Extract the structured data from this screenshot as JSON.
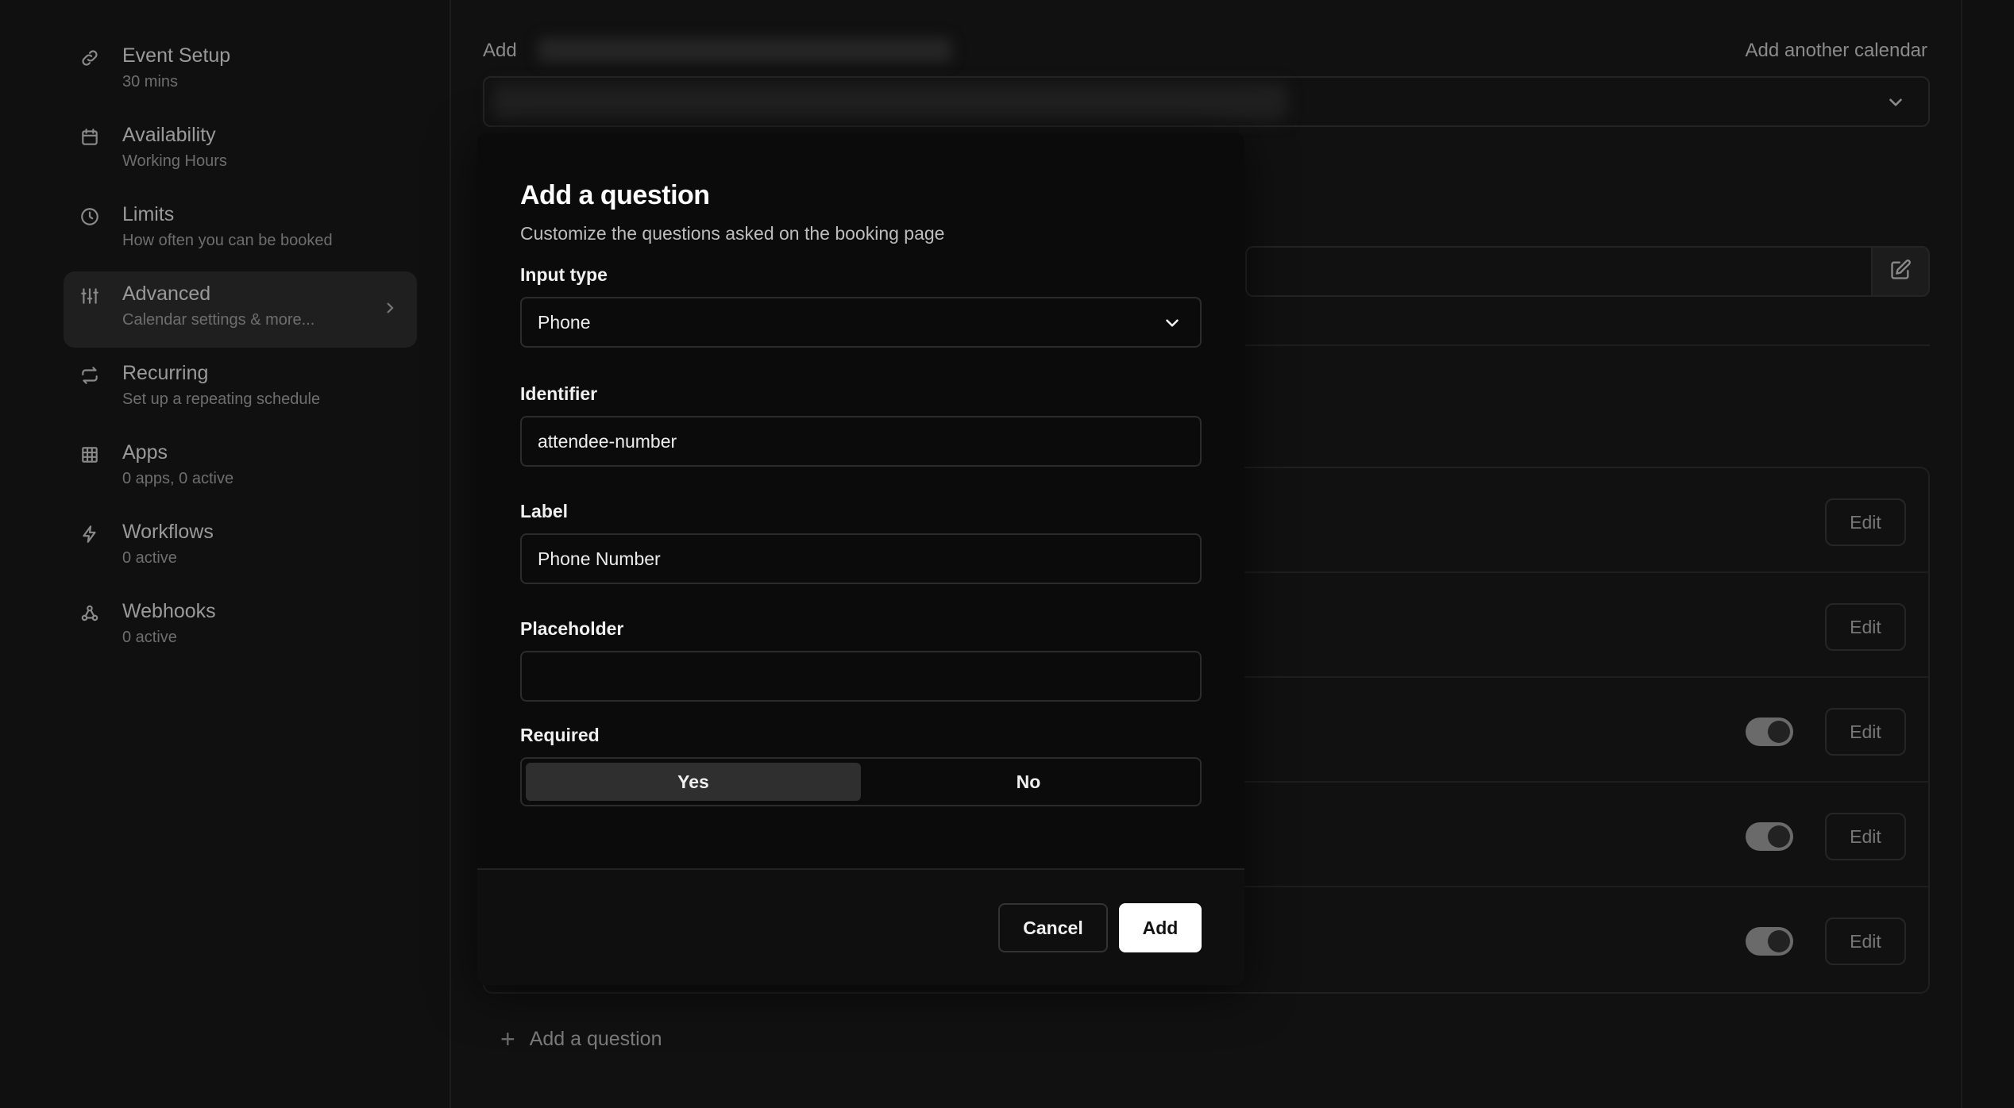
{
  "sidebar": {
    "items": [
      {
        "title": "Event Setup",
        "subtitle": "30 mins",
        "icon": "link-icon"
      },
      {
        "title": "Availability",
        "subtitle": "Working Hours",
        "icon": "calendar-icon"
      },
      {
        "title": "Limits",
        "subtitle": "How often you can be booked",
        "icon": "clock-icon"
      },
      {
        "title": "Advanced",
        "subtitle": "Calendar settings & more...",
        "icon": "sliders-icon",
        "active": true
      },
      {
        "title": "Recurring",
        "subtitle": "Set up a repeating schedule",
        "icon": "repeat-icon"
      },
      {
        "title": "Apps",
        "subtitle": "0 apps, 0 active",
        "icon": "grid-icon"
      },
      {
        "title": "Workflows",
        "subtitle": "0 active",
        "icon": "bolt-icon"
      },
      {
        "title": "Webhooks",
        "subtitle": "0 active",
        "icon": "webhook-icon"
      }
    ]
  },
  "main": {
    "calendar_label": "Add",
    "add_calendar_link": "Add another calendar",
    "question_edit_label": "Edit",
    "add_question_label": "Add a question"
  },
  "modal": {
    "title": "Add a question",
    "subtitle": "Customize the questions asked on the booking page",
    "input_type_label": "Input type",
    "input_type_value": "Phone",
    "identifier_label": "Identifier",
    "identifier_value": "attendee-number",
    "label_label": "Label",
    "label_value": "Phone Number",
    "placeholder_label": "Placeholder",
    "placeholder_value": "",
    "required_label": "Required",
    "required_yes": "Yes",
    "required_no": "No",
    "cancel_label": "Cancel",
    "add_label": "Add"
  },
  "colors": {
    "background": "#101010",
    "modal": "#0b0b0b",
    "primary_button": "#ffffff"
  }
}
